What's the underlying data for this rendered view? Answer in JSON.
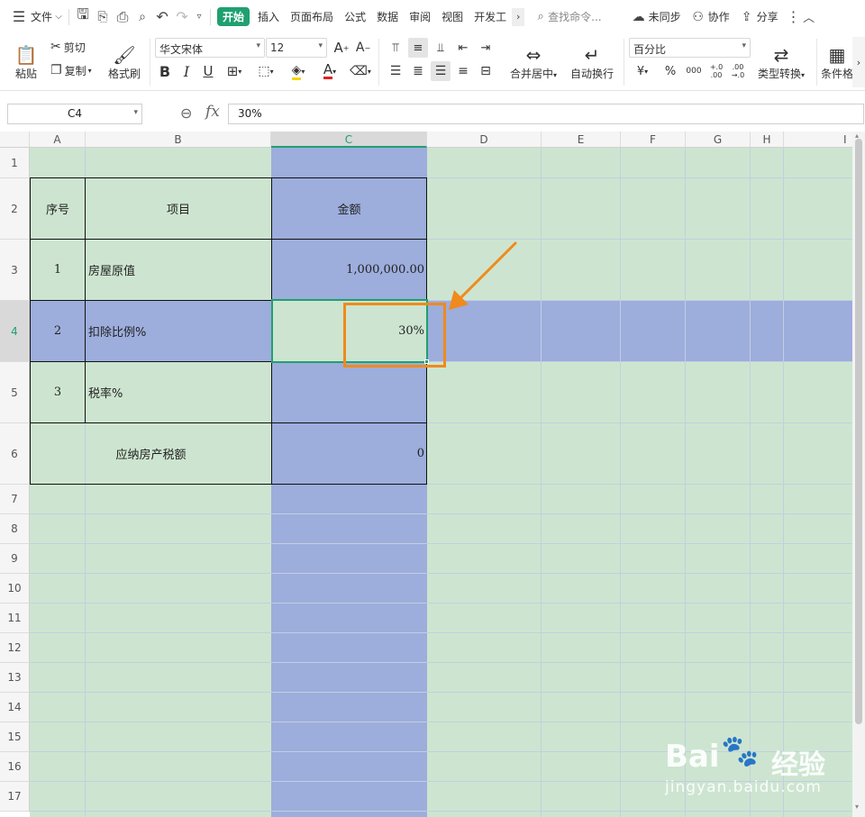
{
  "menubar": {
    "menu_icon": "hamburger-icon",
    "file_label": "文件",
    "tabs": [
      "开始",
      "插入",
      "页面布局",
      "公式",
      "数据",
      "审阅",
      "视图",
      "开发工"
    ],
    "active_tab": "开始",
    "search_placeholder": "查找命令...",
    "sync_label": "未同步",
    "collab_label": "协作",
    "share_label": "分享"
  },
  "ribbon": {
    "paste_label": "粘贴",
    "cut_label": "剪切",
    "copy_label": "复制",
    "format_painter_label": "格式刷",
    "font_name": "华文宋体",
    "font_size": "12",
    "merge_center_label": "合并居中",
    "wrap_text_label": "自动换行",
    "number_format": "百分比",
    "type_convert_label": "类型转换",
    "cond_format_label": "条件格",
    "bold": "B",
    "italic": "I",
    "underline": "U",
    "font_color_letter": "A",
    "currency_symbol": "¥",
    "percent_symbol": "%",
    "thousands_symbol": "000",
    "inc_decimal": "+.0 .00",
    "dec_decimal": ".00 →.0"
  },
  "formula_bar": {
    "cell_ref": "C4",
    "fx_label": "fx",
    "value": "30%"
  },
  "columns": [
    "A",
    "B",
    "C",
    "D",
    "E",
    "F",
    "G",
    "H",
    "I"
  ],
  "selected_column": "C",
  "rows": [
    "1",
    "2",
    "3",
    "4",
    "5",
    "6",
    "7",
    "8",
    "9",
    "10",
    "11",
    "12",
    "13",
    "14",
    "15",
    "16",
    "17"
  ],
  "selected_row": "4",
  "table": {
    "header_no": "序号",
    "header_item": "项目",
    "header_amount": "金额",
    "row3": {
      "no": "1",
      "item": "房屋原值",
      "amount": "1,000,000.00"
    },
    "row4": {
      "no": "2",
      "item": "扣除比例%",
      "amount": "30%"
    },
    "row5": {
      "no": "3",
      "item": "税率%",
      "amount": ""
    },
    "row6": {
      "item": "应纳房产税额",
      "amount": "0"
    }
  },
  "colors": {
    "sheet_green": "#cde5d0",
    "highlight_blue": "#9daddc",
    "selection_green": "#1fa070",
    "annotation_orange": "#f08a1c"
  },
  "watermark": {
    "logo": "Bai",
    "logo_suffix": "经验",
    "url": "jingyan.baidu.com"
  }
}
